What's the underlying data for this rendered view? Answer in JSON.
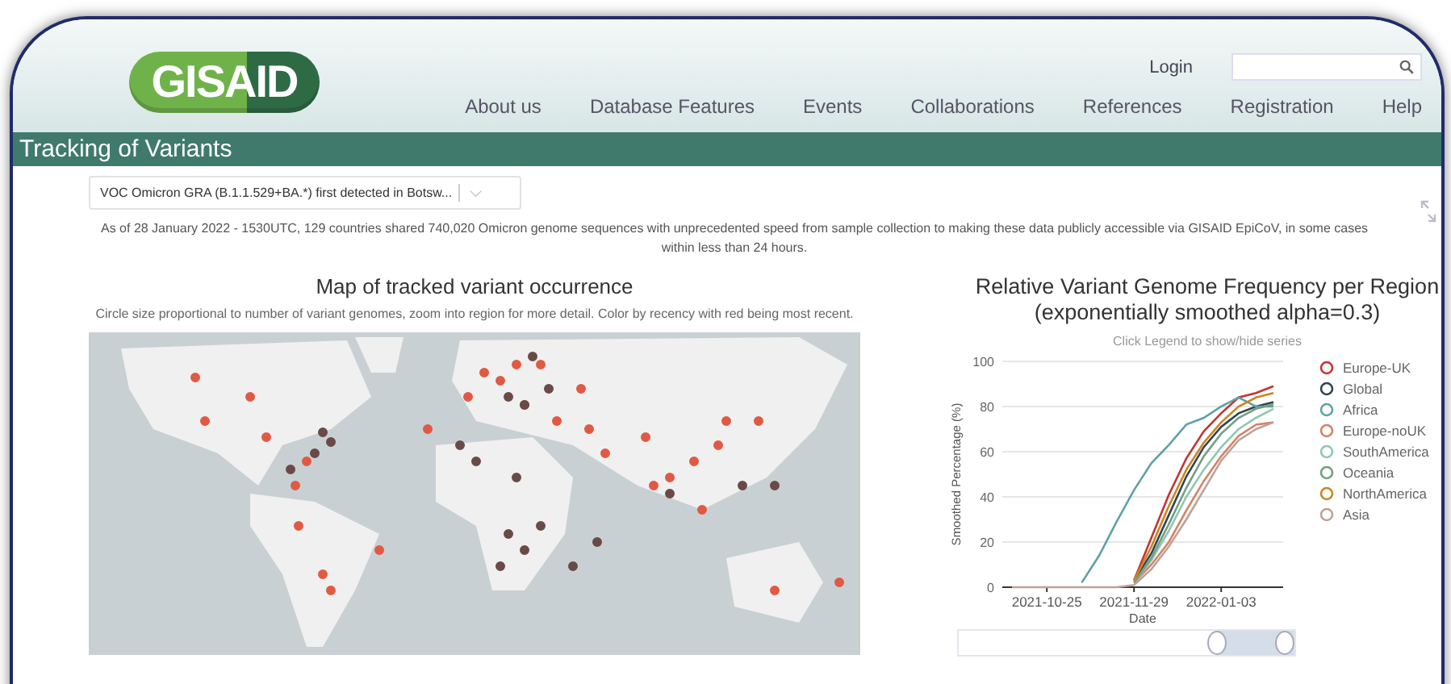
{
  "header": {
    "logo": "GISAID",
    "login": "Login",
    "nav": [
      "About us",
      "Database Features",
      "Events",
      "Collaborations",
      "References",
      "Registration",
      "Help"
    ]
  },
  "title_bar": "Tracking of Variants",
  "variant_select": {
    "value": "VOC Omicron GRA (B.1.1.529+BA.*) first detected in Botsw...",
    "caret": "⌵"
  },
  "summary": "As of 28 January 2022 - 1530UTC, 129 countries shared 740,020 Omicron genome sequences with unprecedented speed from sample collection to making these data publicly accessible via GISAID EpiCoV, in some cases within less than 24 hours.",
  "map_panel": {
    "title": "Map of tracked variant occurrence",
    "caption": "Circle size proportional to number of variant genomes, zoom into region for more detail. Color by recency with red being most recent."
  },
  "chart_panel": {
    "title": "Relative Variant Genome Frequency per Region",
    "subtitle": "(exponentially smoothed alpha=0.3)",
    "hint": "Click Legend to show/hide series",
    "chart_data": {
      "type": "line",
      "xlabel": "Date",
      "ylabel": "Smoothed Percentage (%)",
      "categories": [
        null,
        null,
        "2021-10-25",
        null,
        null,
        null,
        null,
        "2021-11-29",
        null,
        null,
        null,
        null,
        "2022-01-03",
        null,
        null,
        null
      ],
      "ylim": [
        0,
        100
      ],
      "yticks": [
        0,
        20,
        40,
        60,
        80,
        100
      ],
      "grid": true,
      "legend": true,
      "series": [
        {
          "name": "Europe-UK",
          "color": "#c23531",
          "values": [
            null,
            null,
            null,
            null,
            null,
            null,
            null,
            3,
            22,
            41,
            57,
            69,
            77,
            84,
            86,
            89
          ]
        },
        {
          "name": "Global",
          "color": "#2f4554",
          "values": [
            null,
            null,
            null,
            null,
            null,
            null,
            null,
            3,
            15,
            32,
            49,
            62,
            71,
            77,
            80,
            82
          ]
        },
        {
          "name": "Africa",
          "color": "#61a0a8",
          "values": [
            null,
            null,
            null,
            null,
            2,
            14,
            29,
            43,
            55,
            63,
            72,
            75,
            80,
            84,
            80,
            80
          ]
        },
        {
          "name": "Europe-noUK",
          "color": "#d48265",
          "values": [
            null,
            null,
            null,
            null,
            null,
            null,
            null,
            2,
            10,
            20,
            34,
            47,
            58,
            67,
            72,
            73
          ]
        },
        {
          "name": "SouthAmerica",
          "color": "#91c7ae",
          "values": [
            null,
            null,
            null,
            null,
            null,
            null,
            null,
            2,
            12,
            25,
            40,
            52,
            62,
            70,
            75,
            79
          ]
        },
        {
          "name": "Oceania",
          "color": "#749f83",
          "values": [
            null,
            null,
            null,
            null,
            null,
            null,
            null,
            2,
            13,
            28,
            44,
            58,
            68,
            75,
            79,
            81
          ]
        },
        {
          "name": "NorthAmerica",
          "color": "#ca8622",
          "values": [
            null,
            null,
            null,
            null,
            null,
            null,
            null,
            3,
            18,
            36,
            52,
            64,
            73,
            80,
            84,
            86
          ]
        },
        {
          "name": "Asia",
          "color": "#bda29a",
          "values": [
            0,
            0,
            0,
            0,
            0,
            0,
            0,
            1,
            8,
            18,
            30,
            43,
            56,
            65,
            70,
            73
          ]
        }
      ]
    },
    "zoom_slider": {
      "level": 0.23
    }
  }
}
